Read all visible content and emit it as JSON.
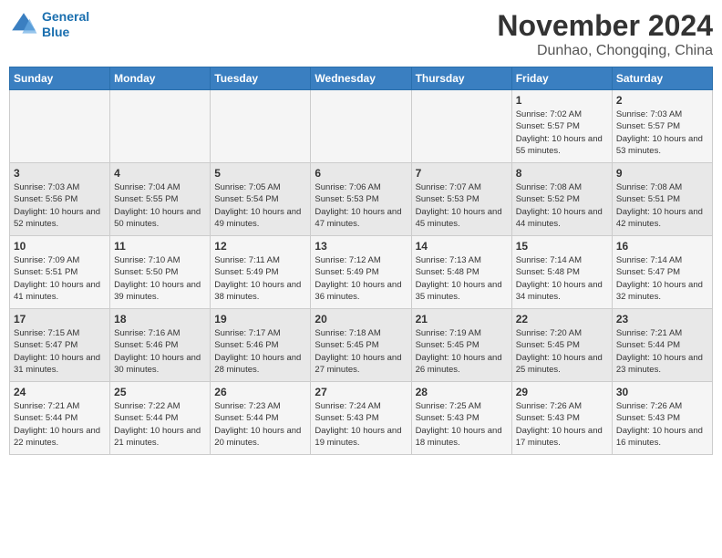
{
  "logo": {
    "line1": "General",
    "line2": "Blue"
  },
  "title": "November 2024",
  "location": "Dunhao, Chongqing, China",
  "weekdays": [
    "Sunday",
    "Monday",
    "Tuesday",
    "Wednesday",
    "Thursday",
    "Friday",
    "Saturday"
  ],
  "weeks": [
    [
      {
        "day": "",
        "info": ""
      },
      {
        "day": "",
        "info": ""
      },
      {
        "day": "",
        "info": ""
      },
      {
        "day": "",
        "info": ""
      },
      {
        "day": "",
        "info": ""
      },
      {
        "day": "1",
        "info": "Sunrise: 7:02 AM\nSunset: 5:57 PM\nDaylight: 10 hours and 55 minutes."
      },
      {
        "day": "2",
        "info": "Sunrise: 7:03 AM\nSunset: 5:57 PM\nDaylight: 10 hours and 53 minutes."
      }
    ],
    [
      {
        "day": "3",
        "info": "Sunrise: 7:03 AM\nSunset: 5:56 PM\nDaylight: 10 hours and 52 minutes."
      },
      {
        "day": "4",
        "info": "Sunrise: 7:04 AM\nSunset: 5:55 PM\nDaylight: 10 hours and 50 minutes."
      },
      {
        "day": "5",
        "info": "Sunrise: 7:05 AM\nSunset: 5:54 PM\nDaylight: 10 hours and 49 minutes."
      },
      {
        "day": "6",
        "info": "Sunrise: 7:06 AM\nSunset: 5:53 PM\nDaylight: 10 hours and 47 minutes."
      },
      {
        "day": "7",
        "info": "Sunrise: 7:07 AM\nSunset: 5:53 PM\nDaylight: 10 hours and 45 minutes."
      },
      {
        "day": "8",
        "info": "Sunrise: 7:08 AM\nSunset: 5:52 PM\nDaylight: 10 hours and 44 minutes."
      },
      {
        "day": "9",
        "info": "Sunrise: 7:08 AM\nSunset: 5:51 PM\nDaylight: 10 hours and 42 minutes."
      }
    ],
    [
      {
        "day": "10",
        "info": "Sunrise: 7:09 AM\nSunset: 5:51 PM\nDaylight: 10 hours and 41 minutes."
      },
      {
        "day": "11",
        "info": "Sunrise: 7:10 AM\nSunset: 5:50 PM\nDaylight: 10 hours and 39 minutes."
      },
      {
        "day": "12",
        "info": "Sunrise: 7:11 AM\nSunset: 5:49 PM\nDaylight: 10 hours and 38 minutes."
      },
      {
        "day": "13",
        "info": "Sunrise: 7:12 AM\nSunset: 5:49 PM\nDaylight: 10 hours and 36 minutes."
      },
      {
        "day": "14",
        "info": "Sunrise: 7:13 AM\nSunset: 5:48 PM\nDaylight: 10 hours and 35 minutes."
      },
      {
        "day": "15",
        "info": "Sunrise: 7:14 AM\nSunset: 5:48 PM\nDaylight: 10 hours and 34 minutes."
      },
      {
        "day": "16",
        "info": "Sunrise: 7:14 AM\nSunset: 5:47 PM\nDaylight: 10 hours and 32 minutes."
      }
    ],
    [
      {
        "day": "17",
        "info": "Sunrise: 7:15 AM\nSunset: 5:47 PM\nDaylight: 10 hours and 31 minutes."
      },
      {
        "day": "18",
        "info": "Sunrise: 7:16 AM\nSunset: 5:46 PM\nDaylight: 10 hours and 30 minutes."
      },
      {
        "day": "19",
        "info": "Sunrise: 7:17 AM\nSunset: 5:46 PM\nDaylight: 10 hours and 28 minutes."
      },
      {
        "day": "20",
        "info": "Sunrise: 7:18 AM\nSunset: 5:45 PM\nDaylight: 10 hours and 27 minutes."
      },
      {
        "day": "21",
        "info": "Sunrise: 7:19 AM\nSunset: 5:45 PM\nDaylight: 10 hours and 26 minutes."
      },
      {
        "day": "22",
        "info": "Sunrise: 7:20 AM\nSunset: 5:45 PM\nDaylight: 10 hours and 25 minutes."
      },
      {
        "day": "23",
        "info": "Sunrise: 7:21 AM\nSunset: 5:44 PM\nDaylight: 10 hours and 23 minutes."
      }
    ],
    [
      {
        "day": "24",
        "info": "Sunrise: 7:21 AM\nSunset: 5:44 PM\nDaylight: 10 hours and 22 minutes."
      },
      {
        "day": "25",
        "info": "Sunrise: 7:22 AM\nSunset: 5:44 PM\nDaylight: 10 hours and 21 minutes."
      },
      {
        "day": "26",
        "info": "Sunrise: 7:23 AM\nSunset: 5:44 PM\nDaylight: 10 hours and 20 minutes."
      },
      {
        "day": "27",
        "info": "Sunrise: 7:24 AM\nSunset: 5:43 PM\nDaylight: 10 hours and 19 minutes."
      },
      {
        "day": "28",
        "info": "Sunrise: 7:25 AM\nSunset: 5:43 PM\nDaylight: 10 hours and 18 minutes."
      },
      {
        "day": "29",
        "info": "Sunrise: 7:26 AM\nSunset: 5:43 PM\nDaylight: 10 hours and 17 minutes."
      },
      {
        "day": "30",
        "info": "Sunrise: 7:26 AM\nSunset: 5:43 PM\nDaylight: 10 hours and 16 minutes."
      }
    ]
  ]
}
